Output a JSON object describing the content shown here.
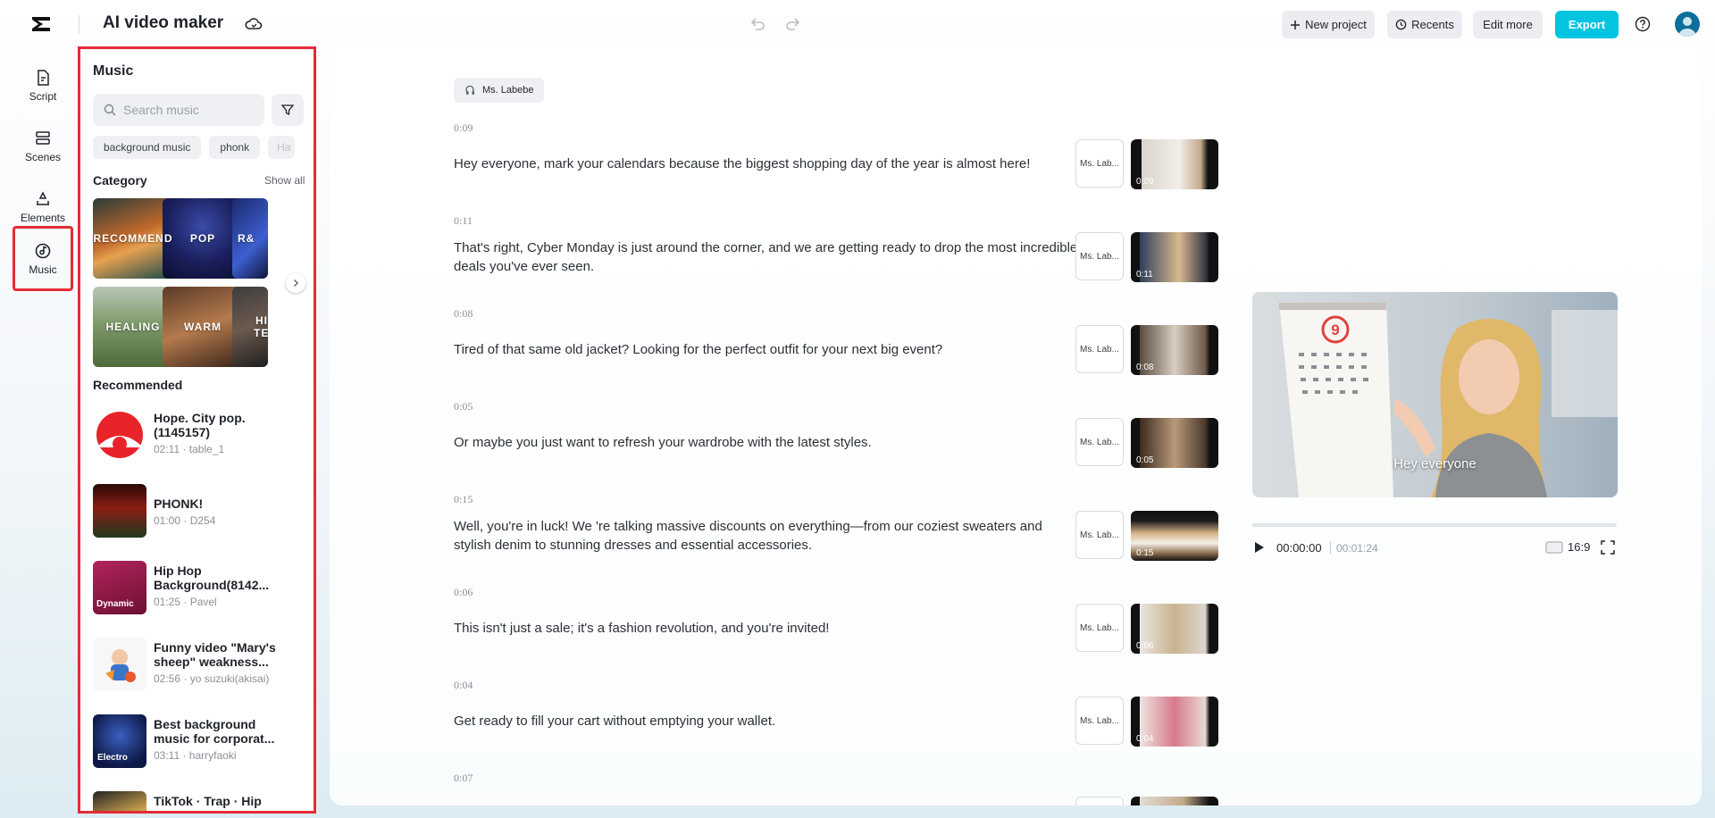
{
  "app": {
    "title": "AI video maker"
  },
  "toolbar": {
    "new_project": "New project",
    "recents": "Recents",
    "edit_more": "Edit more",
    "export": "Export"
  },
  "rail": {
    "items": [
      {
        "label": "Script",
        "icon": "script-icon"
      },
      {
        "label": "Scenes",
        "icon": "scenes-icon"
      },
      {
        "label": "Elements",
        "icon": "elements-icon"
      },
      {
        "label": "Music",
        "icon": "music-icon",
        "active": true
      }
    ]
  },
  "music_panel": {
    "title": "Music",
    "search_placeholder": "Search music",
    "chips": [
      "background music",
      "phonk",
      "Ha"
    ],
    "category_title": "Category",
    "show_all": "Show all",
    "categories": [
      "RECOMMEND",
      "POP",
      "R&",
      "HEALING",
      "WARM",
      "HIG TEM"
    ],
    "recommended_title": "Recommended",
    "tracks": [
      {
        "name": "Hope. City pop.(1145157)",
        "meta": "02:11 · table_1"
      },
      {
        "name": "PHONK!",
        "meta": "01:00 · D254"
      },
      {
        "name": "Hip Hop Background(8142...",
        "meta": "01:25 · Pavel",
        "cover_label": "Dynamic"
      },
      {
        "name": "Funny video \"Mary's sheep\" weakness...",
        "meta": "02:56 · yo suzuki(akisai)"
      },
      {
        "name": "Best background music for corporat...",
        "meta": "03:11 · harryfaoki",
        "cover_label": "Electro"
      },
      {
        "name": "TikTok · Trap · Hip",
        "meta": ""
      }
    ]
  },
  "script": {
    "speaker": "Ms. Labebe",
    "voice_short": "Ms. Lab...",
    "scenes": [
      {
        "time": "0:09",
        "text": "Hey everyone, mark your calendars because the biggest shopping day of the year is almost here!",
        "thumb_time": "0:09"
      },
      {
        "time": "0:11",
        "text": "That's right, Cyber Monday is just around the corner, and we are getting ready to drop the most incredible deals you've ever seen.",
        "thumb_time": "0:11"
      },
      {
        "time": "0:08",
        "text": "Tired of that same old jacket? Looking for the perfect outfit for your next big event?",
        "thumb_time": "0:08"
      },
      {
        "time": "0:05",
        "text": "Or maybe you just want to refresh your wardrobe with the latest styles.",
        "thumb_time": "0:05"
      },
      {
        "time": "0:15",
        "text": "Well, you're in luck! We 're talking massive discounts on everything—from our coziest sweaters and stylish denim to stunning dresses and essential accessories.",
        "thumb_time": "0:15"
      },
      {
        "time": "0:06",
        "text": "This isn't just a sale; it's a fashion revolution, and you're invited!",
        "thumb_time": "0:06"
      },
      {
        "time": "0:04",
        "text": "Get ready to fill your cart without emptying your wallet.",
        "thumb_time": "0:04"
      },
      {
        "time": "0:07",
        "text": "",
        "thumb_time": ""
      }
    ]
  },
  "preview": {
    "caption": "Hey everyone",
    "current_time": "00:00:00",
    "total_time": "00:01:24",
    "progress": 0,
    "aspect_ratio": "16:9"
  },
  "colors": {
    "accent": "#00c4e0",
    "highlight": "#e52b36"
  }
}
